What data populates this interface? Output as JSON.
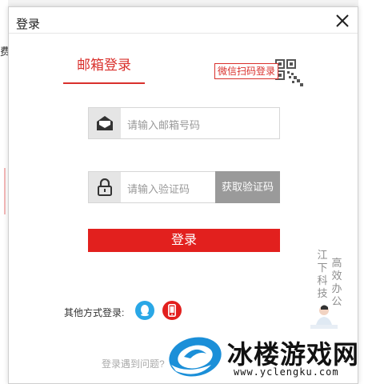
{
  "background": {
    "partial_char": "费"
  },
  "dialog": {
    "title": "登录",
    "close_icon": "close-icon",
    "tab_email": "邮箱登录",
    "wechat_login": "微信扫码登录",
    "qr_icon": "qr-code-icon",
    "email": {
      "placeholder": "请输入邮箱号码",
      "icon": "envelope-icon"
    },
    "code": {
      "placeholder": "请输入验证码",
      "icon": "lock-icon",
      "button": "获取验证码"
    },
    "login_button": "登录",
    "other_methods": "其他方式登录:",
    "qq_icon": "qq-icon",
    "phone_icon": "phone-icon",
    "problem_link": "登录遇到问题?"
  },
  "watermark": {
    "col1": [
      "江",
      "下",
      "科",
      "技"
    ],
    "col2": [
      "高",
      "效",
      "办",
      "公"
    ],
    "brand_name": "冰楼游戏网",
    "brand_url": "www.yclengku.com"
  },
  "colors": {
    "accent": "#e2201e",
    "tab": "#d9302c",
    "qq": "#29a7e6",
    "code_button": "#9a9a9a"
  }
}
